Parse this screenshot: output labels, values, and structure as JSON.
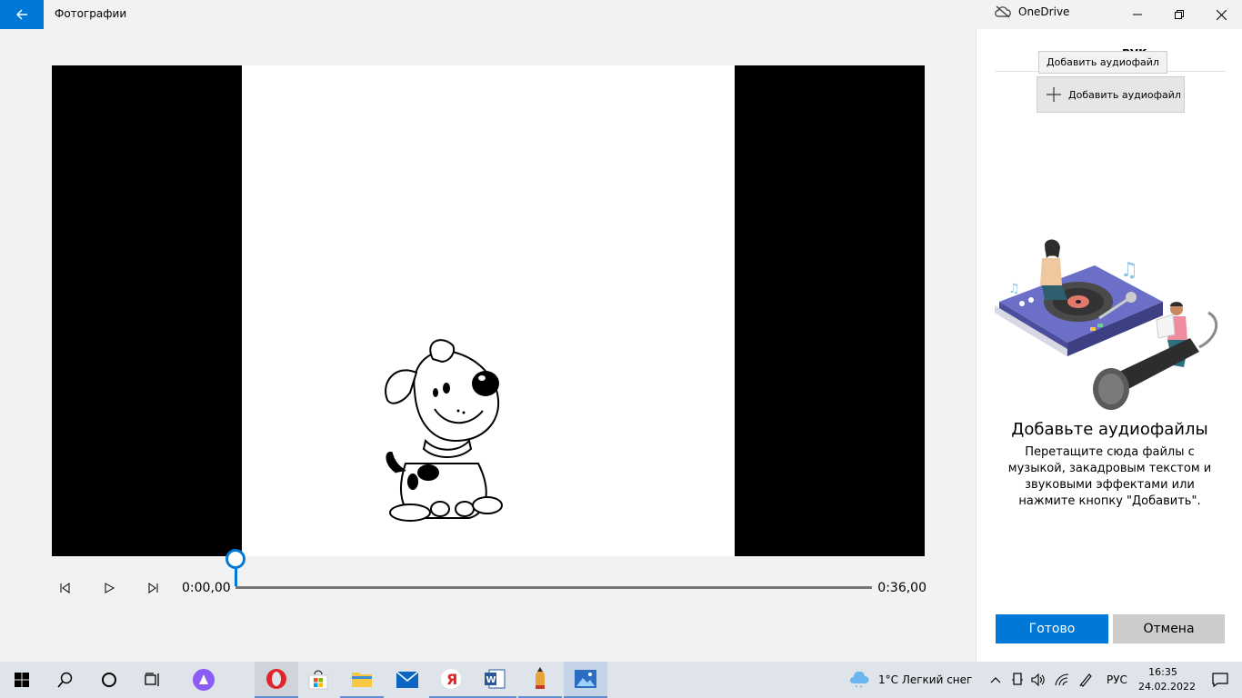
{
  "titlebar": {
    "app_title": "Фотографии",
    "onedrive_label": "OneDrive",
    "back_icon": "arrow-left-icon",
    "accent": "#0078d7"
  },
  "editor": {
    "time_current": "0:00,00",
    "time_total": "0:36,00",
    "playback_progress": 0
  },
  "panel": {
    "title_partial": "вук",
    "tooltip": "Добавить аудиофайл",
    "add_audio_label": "Добавить аудиофайл",
    "empty_heading": "Добавьте аудиофайлы",
    "empty_text": "Перетащите сюда файлы с музыкой, закадровым текстом и звуковыми эффектами или нажмите кнопку \"Добавить\".",
    "done_label": "Готово",
    "cancel_label": "Отмена"
  },
  "taskbar": {
    "weather": "1°C  Легкий снег",
    "language": "РУС",
    "time": "16:35",
    "date": "24.02.2022"
  }
}
